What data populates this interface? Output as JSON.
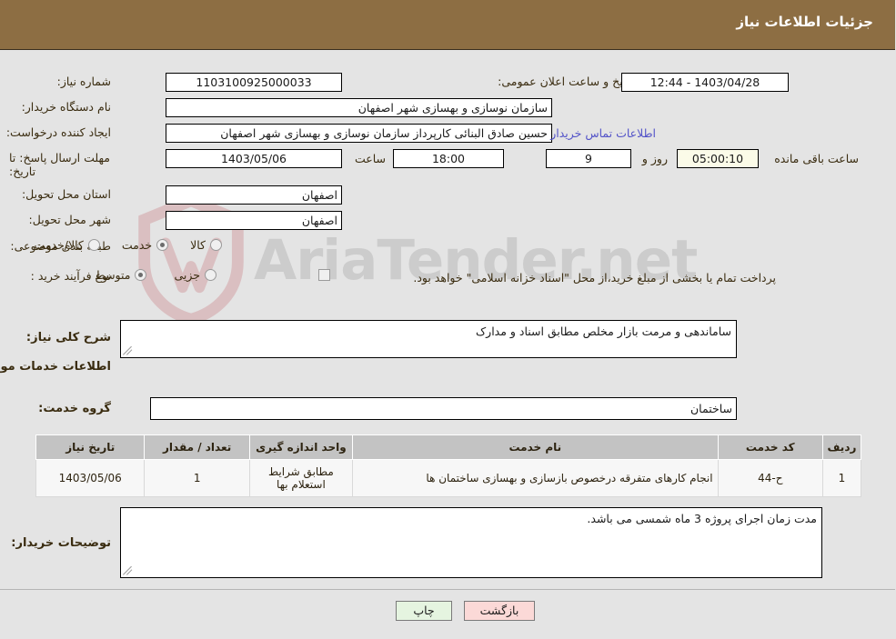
{
  "header": {
    "title": "جزئیات اطلاعات نیاز"
  },
  "form": {
    "need_number": {
      "label": "شماره نیاز:",
      "value": "1103100925000033"
    },
    "announce_datetime": {
      "label": "تاریخ و ساعت اعلان عمومی:",
      "value": "1403/04/28 - 12:44"
    },
    "buyer_org": {
      "label": "نام دستگاه خریدار:",
      "value": "سازمان نوسازی و بهسازی شهر اصفهان"
    },
    "requester": {
      "label": "ایجاد کننده درخواست:",
      "value": "حسین صادق البنائی کارپرداز سازمان نوسازی و بهسازی شهر اصفهان"
    },
    "contact_link": "اطلاعات تماس خریدار",
    "deadline": {
      "label": "مهلت ارسال پاسخ: تا تاریخ:",
      "date": "1403/05/06",
      "hour_label": "ساعت",
      "hour": "18:00",
      "days": "9",
      "days_unit": "روز و",
      "countdown": "05:00:10",
      "countdown_unit": "ساعت باقی مانده"
    },
    "province": {
      "label": "استان محل تحویل:",
      "value": "اصفهان"
    },
    "city": {
      "label": "شهر محل تحویل:",
      "value": "اصفهان"
    },
    "category": {
      "label": "طبقه بندی موضوعی:",
      "options": [
        "کالا",
        "خدمت",
        "کالا/خدمت"
      ],
      "selected": "خدمت"
    },
    "process_type": {
      "label": "نوع فرآیند خرید :",
      "options": [
        "جزیی",
        "متوسط"
      ],
      "selected": "متوسط",
      "treasury_checkbox_label": "پرداخت تمام یا بخشی از مبلغ خرید،از محل \"اسناد خزانه اسلامی\" خواهد بود.",
      "treasury_checked": false
    }
  },
  "description": {
    "label": "شرح کلی نیاز:",
    "value": "ساماندهی و مرمت بازار مخلص مطابق اسناد و مدارک"
  },
  "services_section": {
    "title": "اطلاعات خدمات مورد نیاز",
    "group_label": "گروه خدمت:",
    "group_value": "ساختمان"
  },
  "table": {
    "headers": [
      "ردیف",
      "کد خدمت",
      "نام خدمت",
      "واحد اندازه گیری",
      "تعداد / مقدار",
      "تاریخ نیاز"
    ],
    "rows": [
      {
        "radif": "1",
        "code": "ح-44",
        "name": "انجام کارهای متفرقه درخصوص بازسازی و بهسازی ساختمان ها",
        "unit": "مطابق شرایط استعلام بها",
        "qty": "1",
        "date": "1403/05/06"
      }
    ]
  },
  "buyer_notes": {
    "label": "توضیحات خریدار:",
    "value": "مدت زمان اجرای پروژه 3 ماه شمسی می باشد."
  },
  "footer": {
    "back_label": "بازگشت",
    "print_label": "چاپ"
  },
  "watermark": {
    "text": "AriaTender.net"
  },
  "colors": {
    "header_bg": "#8d6e43",
    "page_bg": "#e4e4e4",
    "label_text": "#3a2c10",
    "link": "#5353c8",
    "table_header_bg": "#c3c3c3",
    "back_button_bg": "#fbd9d7",
    "print_button_bg": "#e5f4e0",
    "timer_bg": "#fbfbe8"
  }
}
